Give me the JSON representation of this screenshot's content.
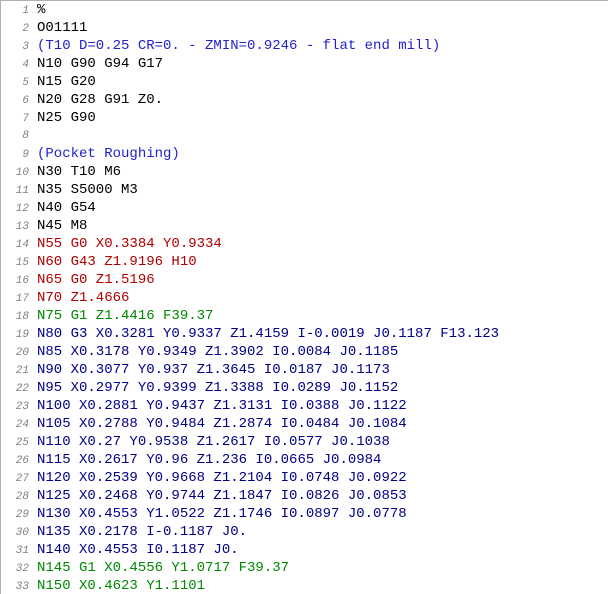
{
  "chart_data": {
    "type": "table",
    "title": "G-code listing",
    "columns": [
      "line_number",
      "code",
      "color_class"
    ],
    "rows": [
      [
        1,
        "%",
        "c-black"
      ],
      [
        2,
        "O01111",
        "c-black"
      ],
      [
        3,
        "(T10 D=0.25 CR=0. - ZMIN=0.9246 - flat end mill)",
        "c-comment"
      ],
      [
        4,
        "N10 G90 G94 G17",
        "c-black"
      ],
      [
        5,
        "N15 G20",
        "c-black"
      ],
      [
        6,
        "N20 G28 G91 Z0.",
        "c-black"
      ],
      [
        7,
        "N25 G90",
        "c-black"
      ],
      [
        8,
        "",
        "c-black"
      ],
      [
        9,
        "(Pocket Roughing)",
        "c-comment"
      ],
      [
        10,
        "N30 T10 M6",
        "c-black"
      ],
      [
        11,
        "N35 S5000 M3",
        "c-black"
      ],
      [
        12,
        "N40 G54",
        "c-black"
      ],
      [
        13,
        "N45 M8",
        "c-black"
      ],
      [
        14,
        "N55 G0 X0.3384 Y0.9334",
        "c-rapid"
      ],
      [
        15,
        "N60 G43 Z1.9196 H10",
        "c-rapid"
      ],
      [
        16,
        "N65 G0 Z1.5196",
        "c-rapid"
      ],
      [
        17,
        "N70 Z1.4666",
        "c-rapid"
      ],
      [
        18,
        "N75 G1 Z1.4416 F39.37",
        "c-feed"
      ],
      [
        19,
        "N80 G3 X0.3281 Y0.9337 Z1.4159 I-0.0019 J0.1187 F13.123",
        "c-arc"
      ],
      [
        20,
        "N85 X0.3178 Y0.9349 Z1.3902 I0.0084 J0.1185",
        "c-arc"
      ],
      [
        21,
        "N90 X0.3077 Y0.937 Z1.3645 I0.0187 J0.1173",
        "c-arc"
      ],
      [
        22,
        "N95 X0.2977 Y0.9399 Z1.3388 I0.0289 J0.1152",
        "c-arc"
      ],
      [
        23,
        "N100 X0.2881 Y0.9437 Z1.3131 I0.0388 J0.1122",
        "c-arc"
      ],
      [
        24,
        "N105 X0.2788 Y0.9484 Z1.2874 I0.0484 J0.1084",
        "c-arc"
      ],
      [
        25,
        "N110 X0.27 Y0.9538 Z1.2617 I0.0577 J0.1038",
        "c-arc"
      ],
      [
        26,
        "N115 X0.2617 Y0.96 Z1.236 I0.0665 J0.0984",
        "c-arc"
      ],
      [
        27,
        "N120 X0.2539 Y0.9668 Z1.2104 I0.0748 J0.0922",
        "c-arc"
      ],
      [
        28,
        "N125 X0.2468 Y0.9744 Z1.1847 I0.0826 J0.0853",
        "c-arc"
      ],
      [
        29,
        "N130 X0.4553 Y1.0522 Z1.1746 I0.0897 J0.0778",
        "c-arc"
      ],
      [
        30,
        "N135 X0.2178 I-0.1187 J0.",
        "c-arc"
      ],
      [
        31,
        "N140 X0.4553 I0.1187 J0.",
        "c-arc"
      ],
      [
        32,
        "N145 G1 X0.4556 Y1.0717 F39.37",
        "c-feed"
      ],
      [
        33,
        "N150 X0.4623 Y1.1101",
        "c-feed"
      ]
    ]
  },
  "lines": [
    {
      "n": "1",
      "text": "%",
      "cls": "c-black"
    },
    {
      "n": "2",
      "text": "O01111",
      "cls": "c-black"
    },
    {
      "n": "3",
      "text": "(T10 D=0.25 CR=0. - ZMIN=0.9246 - flat end mill)",
      "cls": "c-comment"
    },
    {
      "n": "4",
      "text": "N10 G90 G94 G17",
      "cls": "c-black"
    },
    {
      "n": "5",
      "text": "N15 G20",
      "cls": "c-black"
    },
    {
      "n": "6",
      "text": "N20 G28 G91 Z0.",
      "cls": "c-black"
    },
    {
      "n": "7",
      "text": "N25 G90",
      "cls": "c-black"
    },
    {
      "n": "8",
      "text": "",
      "cls": "c-black"
    },
    {
      "n": "9",
      "text": "(Pocket Roughing)",
      "cls": "c-comment"
    },
    {
      "n": "10",
      "text": "N30 T10 M6",
      "cls": "c-black"
    },
    {
      "n": "11",
      "text": "N35 S5000 M3",
      "cls": "c-black"
    },
    {
      "n": "12",
      "text": "N40 G54",
      "cls": "c-black"
    },
    {
      "n": "13",
      "text": "N45 M8",
      "cls": "c-black"
    },
    {
      "n": "14",
      "text": "N55 G0 X0.3384 Y0.9334",
      "cls": "c-rapid"
    },
    {
      "n": "15",
      "text": "N60 G43 Z1.9196 H10",
      "cls": "c-rapid"
    },
    {
      "n": "16",
      "text": "N65 G0 Z1.5196",
      "cls": "c-rapid"
    },
    {
      "n": "17",
      "text": "N70 Z1.4666",
      "cls": "c-rapid"
    },
    {
      "n": "18",
      "text": "N75 G1 Z1.4416 F39.37",
      "cls": "c-feed"
    },
    {
      "n": "19",
      "text": "N80 G3 X0.3281 Y0.9337 Z1.4159 I-0.0019 J0.1187 F13.123",
      "cls": "c-arc"
    },
    {
      "n": "20",
      "text": "N85 X0.3178 Y0.9349 Z1.3902 I0.0084 J0.1185",
      "cls": "c-arc"
    },
    {
      "n": "21",
      "text": "N90 X0.3077 Y0.937 Z1.3645 I0.0187 J0.1173",
      "cls": "c-arc"
    },
    {
      "n": "22",
      "text": "N95 X0.2977 Y0.9399 Z1.3388 I0.0289 J0.1152",
      "cls": "c-arc"
    },
    {
      "n": "23",
      "text": "N100 X0.2881 Y0.9437 Z1.3131 I0.0388 J0.1122",
      "cls": "c-arc"
    },
    {
      "n": "24",
      "text": "N105 X0.2788 Y0.9484 Z1.2874 I0.0484 J0.1084",
      "cls": "c-arc"
    },
    {
      "n": "25",
      "text": "N110 X0.27 Y0.9538 Z1.2617 I0.0577 J0.1038",
      "cls": "c-arc"
    },
    {
      "n": "26",
      "text": "N115 X0.2617 Y0.96 Z1.236 I0.0665 J0.0984",
      "cls": "c-arc"
    },
    {
      "n": "27",
      "text": "N120 X0.2539 Y0.9668 Z1.2104 I0.0748 J0.0922",
      "cls": "c-arc"
    },
    {
      "n": "28",
      "text": "N125 X0.2468 Y0.9744 Z1.1847 I0.0826 J0.0853",
      "cls": "c-arc"
    },
    {
      "n": "29",
      "text": "N130 X0.4553 Y1.0522 Z1.1746 I0.0897 J0.0778",
      "cls": "c-arc"
    },
    {
      "n": "30",
      "text": "N135 X0.2178 I-0.1187 J0.",
      "cls": "c-arc"
    },
    {
      "n": "31",
      "text": "N140 X0.4553 I0.1187 J0.",
      "cls": "c-arc"
    },
    {
      "n": "32",
      "text": "N145 G1 X0.4556 Y1.0717 F39.37",
      "cls": "c-feed"
    },
    {
      "n": "33",
      "text": "N150 X0.4623 Y1.1101",
      "cls": "c-feed"
    }
  ]
}
